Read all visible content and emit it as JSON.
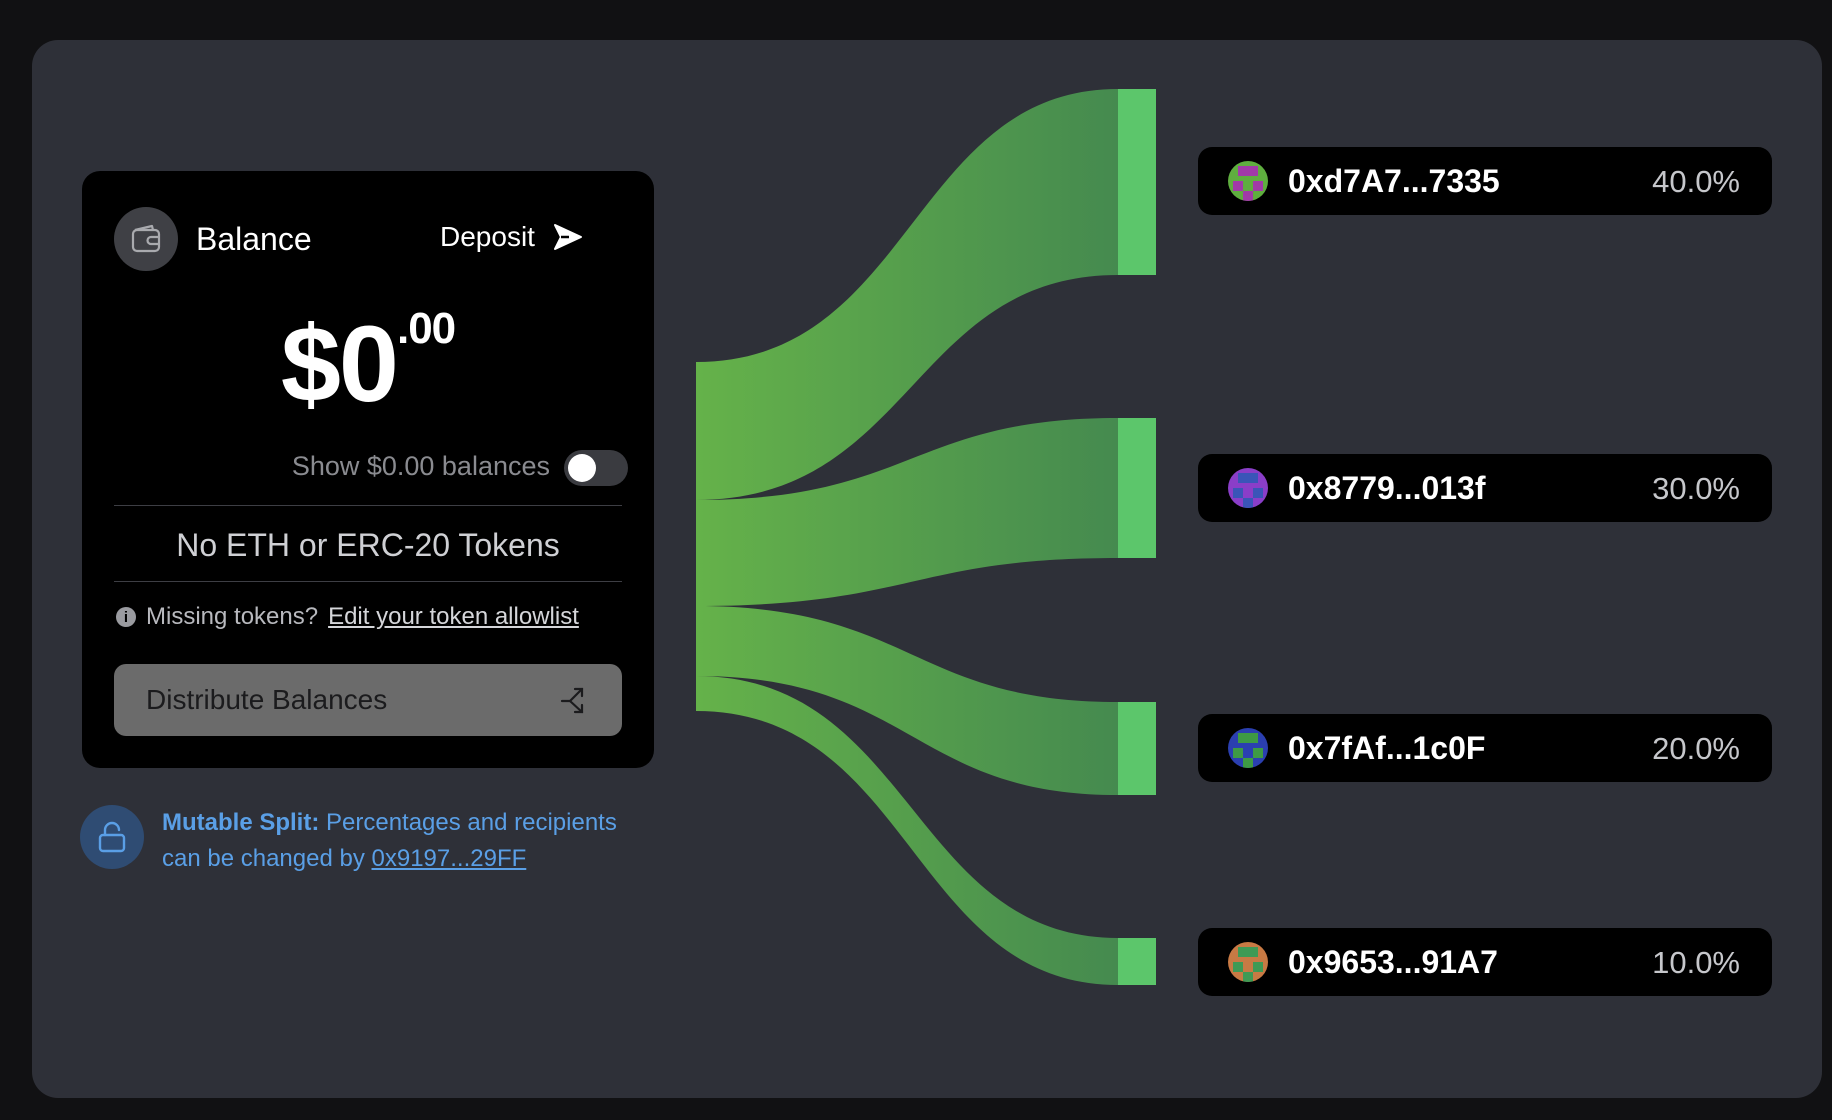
{
  "balance_card": {
    "title": "Balance",
    "deposit_label": "Deposit",
    "amount_whole": "$0",
    "amount_cents": ".00",
    "show_zero_label": "Show $0.00 balances",
    "show_zero_enabled": false,
    "empty_message": "No ETH or ERC-20 Tokens",
    "missing_prefix": "Missing tokens?",
    "allowlist_link": "Edit your token allowlist",
    "distribute_label": "Distribute Balances"
  },
  "mutable_notice": {
    "label": "Mutable Split:",
    "text": "Percentages and recipients can be changed by",
    "owner": "0x9197...29FF"
  },
  "recipients": [
    {
      "address": "0xd7A7...7335",
      "percent": "40.0%",
      "avatar_colors": [
        "#5fae3f",
        "#a13aa8"
      ]
    },
    {
      "address": "0x8779...013f",
      "percent": "30.0%",
      "avatar_colors": [
        "#8a3ec8",
        "#3a55b8"
      ]
    },
    {
      "address": "0x7fAf...1c0F",
      "percent": "20.0%",
      "avatar_colors": [
        "#2b3fb0",
        "#3e9a44"
      ]
    },
    {
      "address": "0x9653...91A7",
      "percent": "10.0%",
      "avatar_colors": [
        "#c87a44",
        "#3f9a55"
      ]
    }
  ],
  "colors": {
    "flow_start": "#65b24a",
    "flow_end": "#458a4f",
    "flow_bar": "#5cc66b",
    "panel": "#2e3038",
    "link_blue": "#5a9fe6"
  }
}
